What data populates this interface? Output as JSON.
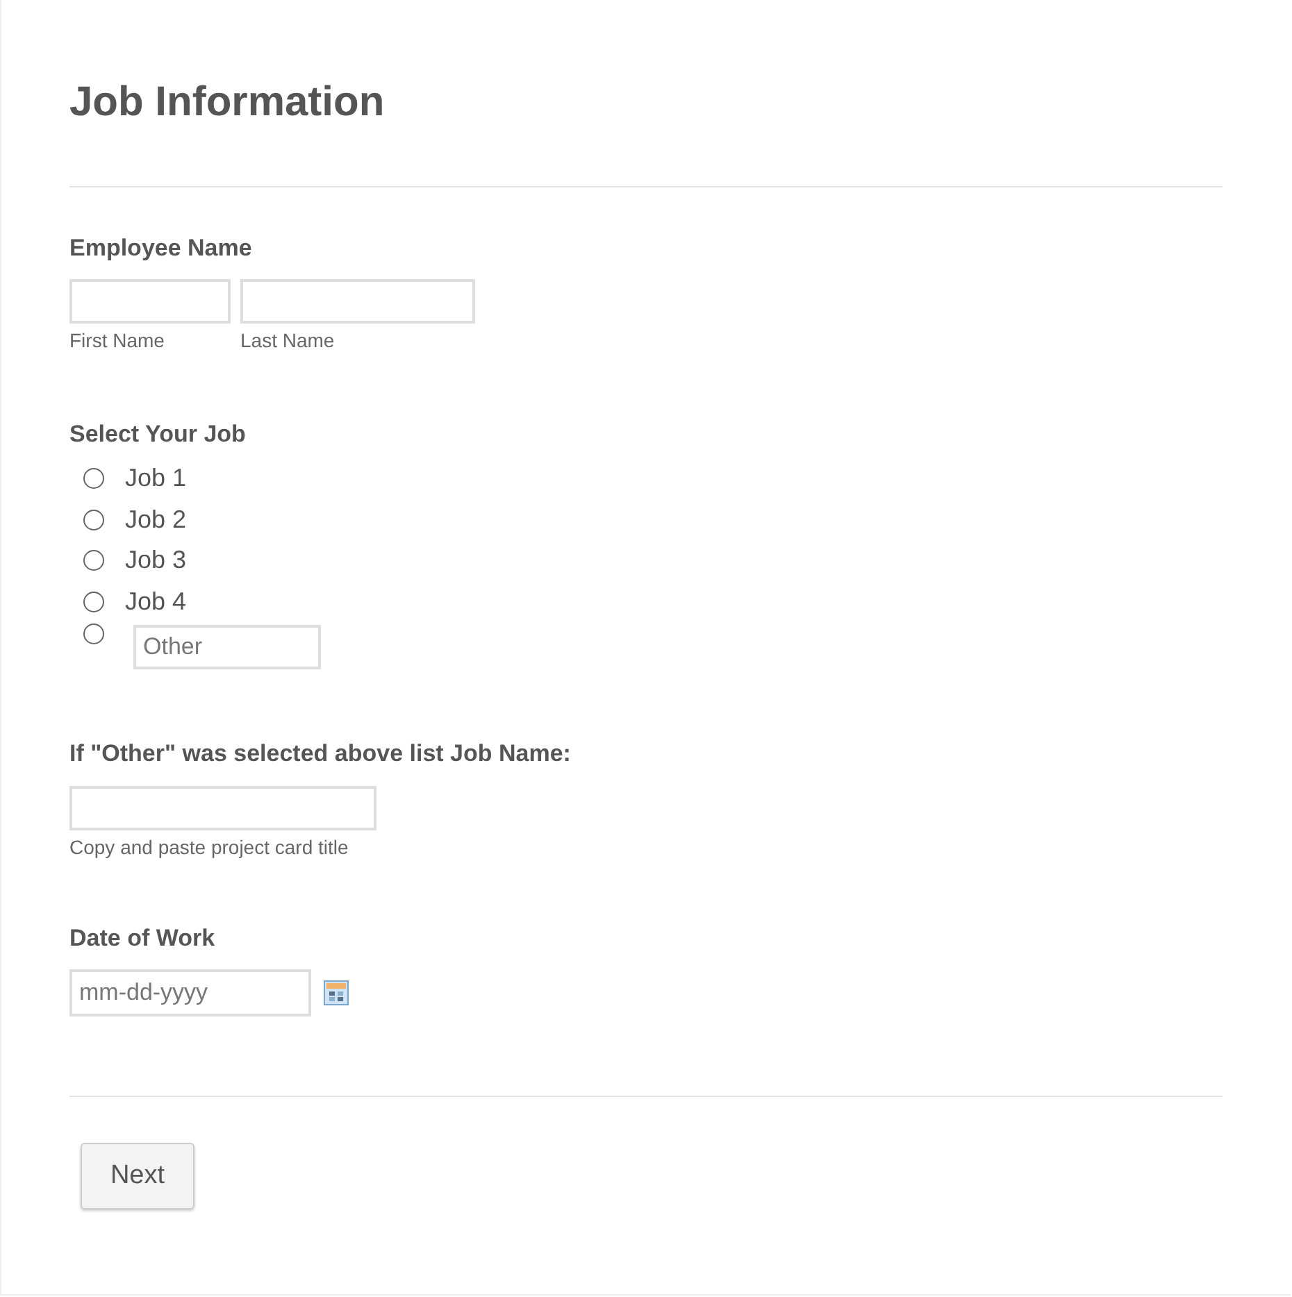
{
  "title": "Job Information",
  "employee_name": {
    "label": "Employee Name",
    "fields": [
      {
        "sublabel": "First Name"
      },
      {
        "sublabel": "Last Name"
      }
    ]
  },
  "job": {
    "label": "Select Your Job",
    "options": [
      {
        "kind": "option",
        "label": "Job 1",
        "selected": false
      },
      {
        "kind": "option",
        "label": "Job 2",
        "selected": false
      },
      {
        "kind": "option",
        "label": "Job 3",
        "selected": false
      },
      {
        "kind": "option",
        "label": "Job 4",
        "selected": false
      },
      {
        "kind": "other",
        "placeholder": "Other",
        "selected": false
      }
    ]
  },
  "other_job": {
    "label": "If \"Other\" was selected above list Job Name:",
    "hint": "Copy and paste project card title"
  },
  "date": {
    "label": "Date of Work",
    "placeholder": "mm-dd-yyyy"
  },
  "buttons": [
    "Next"
  ]
}
